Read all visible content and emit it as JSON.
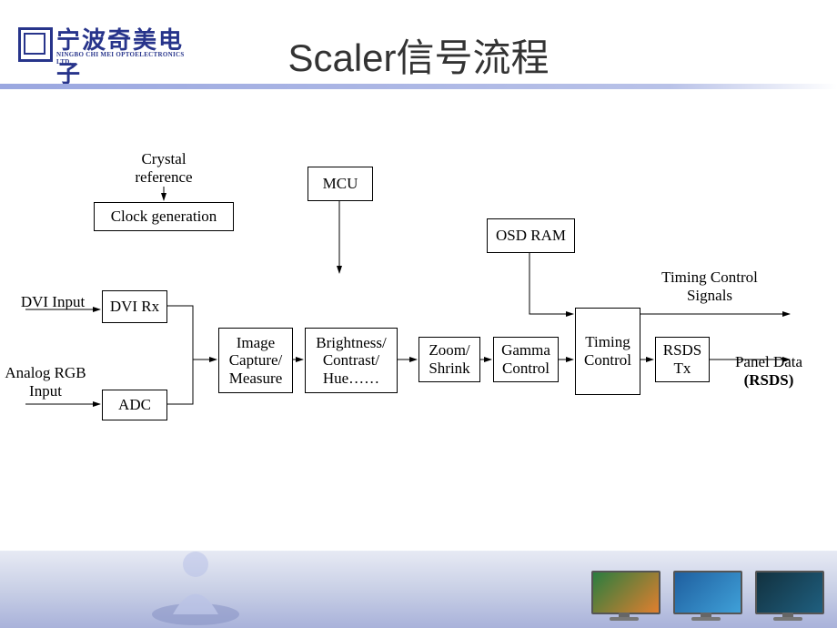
{
  "logo": {
    "cn": "宁波奇美电子",
    "en": "NINGBO CHI MEI OPTOELECTRONICS LTD."
  },
  "title": "Scaler信号流程",
  "labels": {
    "crystal": "Crystal\nreference",
    "dvi_input": "DVI Input",
    "analog_input": "Analog RGB\nInput",
    "timing_out": "Timing Control\nSignals",
    "panel_out": "Panel Data\n(RSDS)"
  },
  "boxes": {
    "clock": "Clock generation",
    "mcu": "MCU",
    "osd": "OSD RAM",
    "dvirx": "DVI Rx",
    "adc": "ADC",
    "capture": "Image\nCapture/\nMeasure",
    "bch": "Brightness/\nContrast/\nHue……",
    "zoom": "Zoom/\nShrink",
    "gamma": "Gamma\nControl",
    "timing": "Timing\nControl",
    "rsds": "RSDS\nTx"
  }
}
